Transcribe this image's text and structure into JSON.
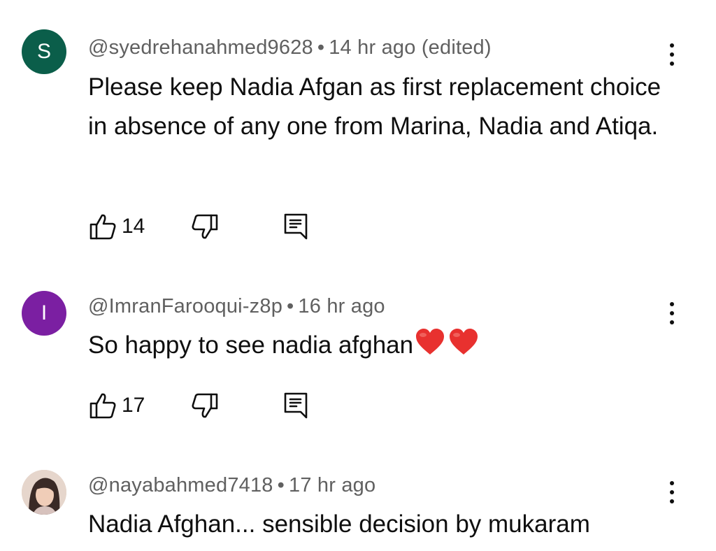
{
  "comments": [
    {
      "avatar_letter": "S",
      "avatar_color": "#0b5e4a",
      "handle": "@syedrehanahmed9628",
      "time": "14 hr ago (edited)",
      "text": "Please keep Nadia Afgan as first replacement choice in absence of any one from Marina, Nadia and Atiqa.",
      "likes": "14",
      "like_icon": "thumbs-up-icon",
      "dislike_icon": "thumbs-down-icon",
      "reply_icon": "comment-reply-icon"
    },
    {
      "avatar_letter": "I",
      "avatar_color": "#7b1fa2",
      "handle": "@ImranFarooqui-z8p",
      "time": "16 hr ago",
      "text": "So happy to see nadia afghan",
      "emoji": "❤️❤️",
      "likes": "17",
      "like_icon": "thumbs-up-icon",
      "dislike_icon": "thumbs-down-icon",
      "reply_icon": "comment-reply-icon"
    },
    {
      "avatar_letter": "",
      "avatar_color": "#c9b2a6",
      "handle": "@nayabahmed7418",
      "time": "17 hr ago",
      "text": "Nadia Afghan... sensible decision by mukaram"
    }
  ],
  "separator": "•",
  "more_icon": "more-vert-icon"
}
